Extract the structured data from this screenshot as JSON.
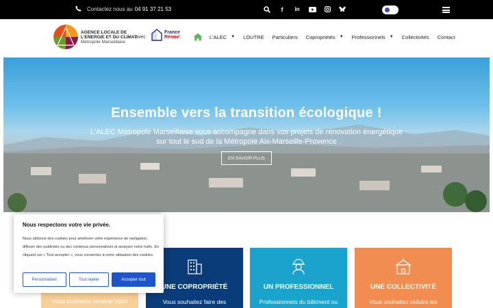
{
  "topbar": {
    "phone_prefix": "Contactez nous au",
    "phone_number": "04 91 37 21 53",
    "icons": [
      "search-icon",
      "facebook-icon",
      "linkedin-icon",
      "youtube-icon",
      "instagram-icon",
      "bluesky-icon"
    ]
  },
  "logo": {
    "line1": "AGENCE LOCALE DE",
    "line2": "L'ENERGIE ET DU CLIMAT",
    "line3": "Métropole Marseillaise"
  },
  "partner": {
    "avec": "avec",
    "name_line1": "France",
    "name_line2": "Rénov'"
  },
  "nav": {
    "items": [
      {
        "label": "L'ALEC",
        "dropdown": true
      },
      {
        "label": "LOUTRE",
        "dropdown": false
      },
      {
        "label": "Particuliers",
        "dropdown": false
      },
      {
        "label": "Copropriétés",
        "dropdown": true
      },
      {
        "label": "Professionnels",
        "dropdown": true
      },
      {
        "label": "Collectivités",
        "dropdown": false
      },
      {
        "label": "Contact",
        "dropdown": false
      }
    ]
  },
  "hero": {
    "title": "Ensemble vers la transition écologique !",
    "subtitle_line1": "L'ALEC Métropole Marseillaise vous accompagne dans vos projets de rénovation énergétique",
    "subtitle_line2": "sur tout le sud de la Métropole Aix-Marseille-Provence",
    "cta": "EN SAVOIR PLUS"
  },
  "cards": [
    {
      "title": "",
      "desc": "Vous souhaitez rénover votre",
      "color": "#f8cf96"
    },
    {
      "title": "UNE COPROPRIÉTÉ",
      "desc": "Vous souhaitez faire des",
      "color": "#0a3c7a"
    },
    {
      "title": "UN PROFESSIONNEL",
      "desc": "Professionnels du bâtiment ou",
      "color": "#1aa3cc"
    },
    {
      "title": "UNE COLLECTIVITÉ",
      "desc": "Vous souhaitez réduire les",
      "color": "#f28d52"
    }
  ],
  "cookie": {
    "title": "Nous respectons votre vie privée.",
    "text": "Nous utilisons des cookies pour améliorer votre expérience de navigation, diffuser des publicités ou des contenus personnalisés et analyser notre trafic. En cliquant sur « Tout accepter », vous consentez à notre utilisation des cookies.",
    "btn_customize": "Personnaliser",
    "btn_reject": "Tout rejeter",
    "btn_accept": "Accepter tout"
  },
  "colors": {
    "accent_blue": "#1e56c7",
    "copro": "#0a3c7a",
    "pro": "#1aa3cc",
    "collectivite": "#f28d52"
  }
}
